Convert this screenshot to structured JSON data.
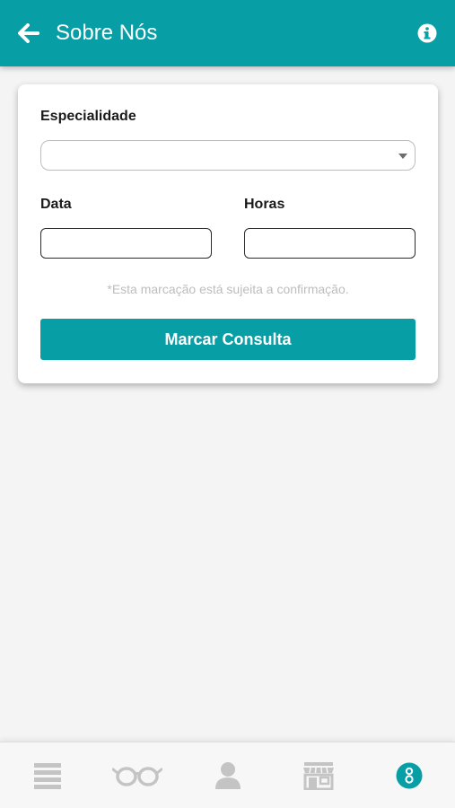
{
  "header": {
    "title": "Sobre Nós",
    "back_icon": "arrow-left-icon",
    "info_icon": "info-circle-icon"
  },
  "form": {
    "specialty_label": "Especialidade",
    "specialty_value": "",
    "date_label": "Data",
    "date_value": "",
    "hours_label": "Horas",
    "hours_value": "",
    "note": "*Esta marcação está sujeita a confirmação.",
    "submit_label": "Marcar Consulta"
  },
  "bottom_nav": {
    "items": [
      {
        "icon": "menu-icon",
        "active": false
      },
      {
        "icon": "glasses-icon",
        "active": false
      },
      {
        "icon": "user-icon",
        "active": false
      },
      {
        "icon": "store-icon",
        "active": false
      },
      {
        "icon": "app-logo-icon",
        "active": true
      }
    ]
  },
  "colors": {
    "accent": "#079ea6",
    "inactive_icon": "#c4c4c4",
    "background": "#f4f4f4"
  }
}
